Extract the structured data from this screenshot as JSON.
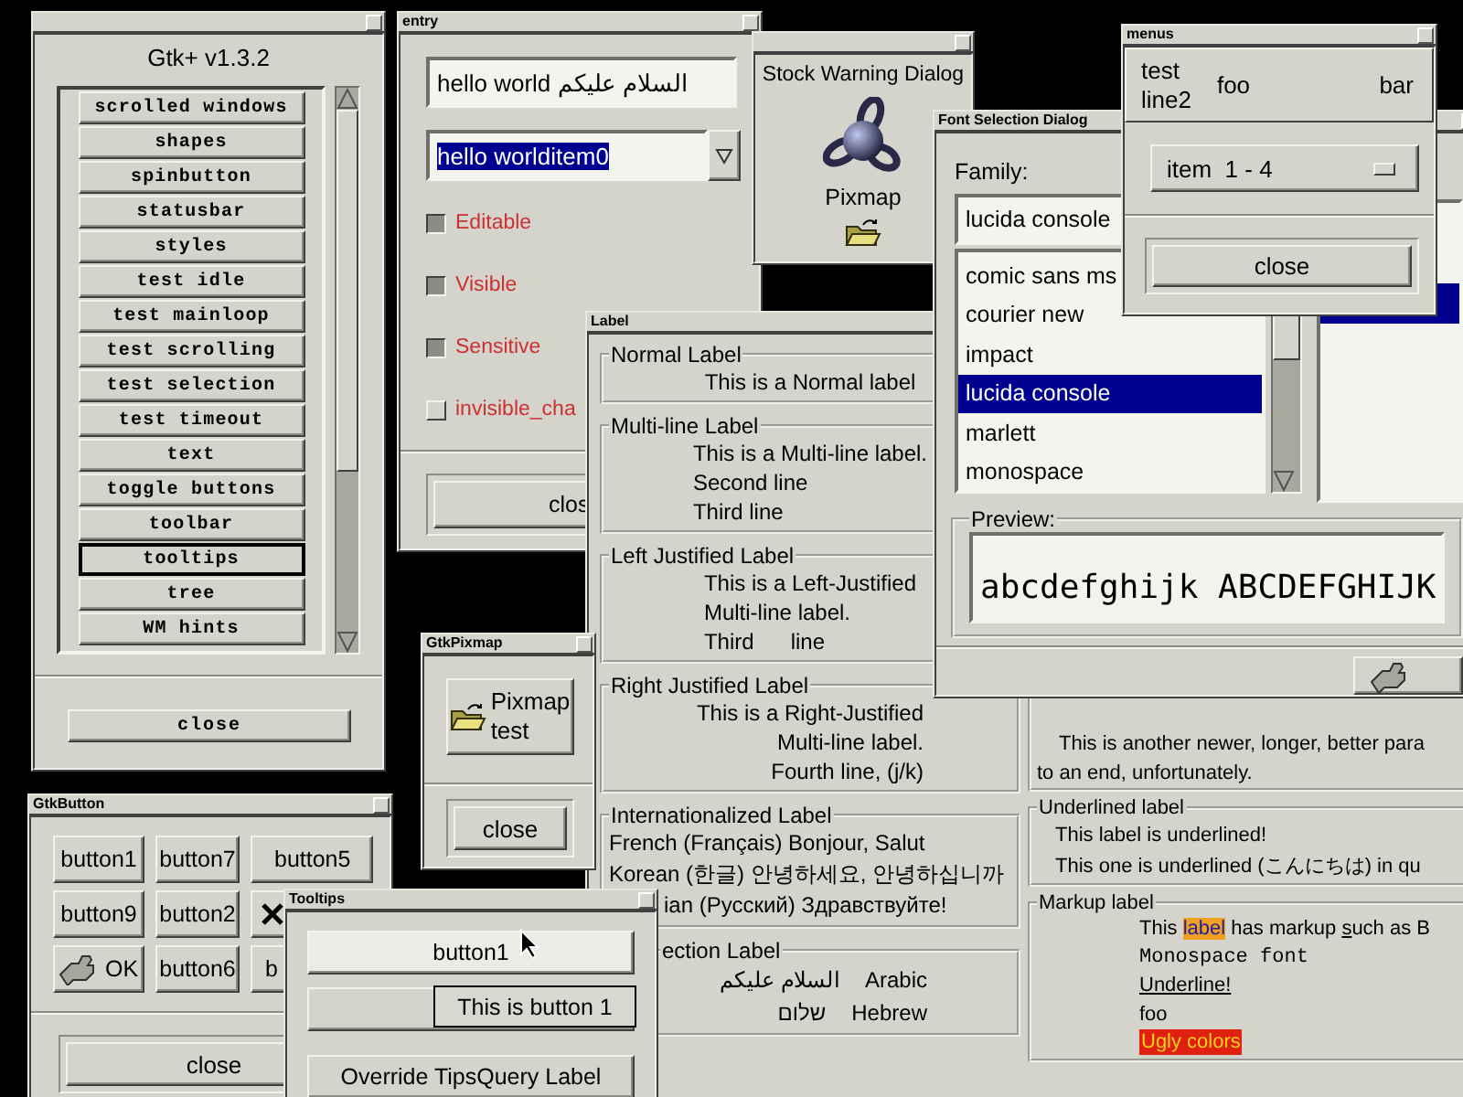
{
  "main_window": {
    "title": "Gtk+ v1.3.2",
    "items": [
      {
        "label": "scrolled windows",
        "focused": false
      },
      {
        "label": "shapes",
        "focused": false
      },
      {
        "label": "spinbutton",
        "focused": false
      },
      {
        "label": "statusbar",
        "focused": false
      },
      {
        "label": "styles",
        "focused": false
      },
      {
        "label": "test idle",
        "focused": false
      },
      {
        "label": "test mainloop",
        "focused": false
      },
      {
        "label": "test scrolling",
        "focused": false
      },
      {
        "label": "test selection",
        "focused": false
      },
      {
        "label": "test timeout",
        "focused": false
      },
      {
        "label": "text",
        "focused": false
      },
      {
        "label": "toggle buttons",
        "focused": false
      },
      {
        "label": "toolbar",
        "focused": false
      },
      {
        "label": "tooltips",
        "focused": true
      },
      {
        "label": "tree",
        "focused": false
      },
      {
        "label": "WM hints",
        "focused": false
      }
    ],
    "close_button": "close"
  },
  "entry_window": {
    "title": "entry",
    "entry_value": "hello world السلام عليكم",
    "combo_value": "hello worlditem0",
    "combo_text_selected": true,
    "checkboxes": [
      {
        "label": "Editable",
        "checked": true
      },
      {
        "label": "Visible",
        "checked": true
      },
      {
        "label": "Sensitive",
        "checked": true
      },
      {
        "label": "invisible_cha",
        "checked": false
      }
    ],
    "close_button": "clos"
  },
  "stock_dialog": {
    "heading": "Stock Warning Dialog",
    "caption": "Pixmap"
  },
  "label_window": {
    "title": "Label",
    "left_frames": [
      {
        "kind": "center",
        "title": "Normal Label",
        "text": "This is a Normal label"
      },
      {
        "kind": "left",
        "title": "Multi-line Label",
        "text": "This is a Multi-line label.\nSecond line\nThird line"
      },
      {
        "kind": "left",
        "title": "Left Justified Label",
        "text": "This is a Left-Justified\nMulti-line label.\nThird      line"
      },
      {
        "kind": "right",
        "title": "Right Justified Label",
        "text": "This is a Right-Justified\nMulti-line label.\nFourth line, (j/k)"
      },
      {
        "kind": "intl",
        "title": "Internationalized Label",
        "lines": [
          "French (Français) Bonjour, Salut",
          "Korean (한글) 안녕하세요, 안녕하십니까",
          "ian (Русский) Здравствуйте!"
        ]
      },
      {
        "kind": "direction",
        "title": "ection Label",
        "lines": [
          {
            "script": "السلام عليكم",
            "language": "Arabic"
          },
          {
            "script": "שלום",
            "language": "Hebrew"
          }
        ]
      }
    ],
    "right_frames": [
      {
        "kind": "paragraph",
        "lines": [
          "This is another newer, longer, better para",
          "to an end, unfortunately."
        ]
      },
      {
        "kind": "underlined",
        "title": "Underlined label",
        "lines": [
          "This label is underlined!",
          "This one is underlined (こんにちは) in qu"
        ]
      },
      {
        "kind": "markup",
        "title": "Markup label",
        "lines": [
          {
            "kind": "rich",
            "parts": [
              {
                "kind": "plain",
                "text": "This "
              },
              {
                "kind": "highlight",
                "text": "label"
              },
              {
                "kind": "plain",
                "text": " has markup "
              },
              {
                "kind": "underline",
                "text": "s"
              },
              {
                "kind": "plain",
                "text": "uch as B"
              }
            ]
          },
          {
            "kind": "mono",
            "text": "Monospace font"
          },
          {
            "kind": "underline",
            "text": "Underline!"
          },
          {
            "kind": "plain",
            "text": "foo"
          },
          {
            "kind": "ugly",
            "text": "Ugly colors"
          }
        ]
      }
    ]
  },
  "font_dialog": {
    "title": "Font Selection Dialog",
    "family_label": "Family:",
    "family_value": "lucida console",
    "families": [
      {
        "name": "comic sans ms",
        "selected": false
      },
      {
        "name": "courier new",
        "selected": false
      },
      {
        "name": "impact",
        "selected": false
      },
      {
        "name": "lucida console",
        "selected": true
      },
      {
        "name": "marlett",
        "selected": false
      },
      {
        "name": "monospace",
        "selected": false
      }
    ],
    "preview_label": "Preview:",
    "preview_text": "abcdefghijk ABCDEFGHIJK"
  },
  "menus_window": {
    "title": "menus",
    "menubar": [
      "test\nline2",
      "foo",
      "bar"
    ],
    "option_menu": "item  1 - 4",
    "close_button": "close"
  },
  "pixmap_window": {
    "title": "GtkPixmap",
    "button_label": "Pixmap\ntest",
    "close_button": "close"
  },
  "button_window": {
    "title": "GtkButton",
    "buttons": [
      {
        "kind": "plain",
        "label": "button1"
      },
      {
        "kind": "plain",
        "label": "button7"
      },
      {
        "kind": "plain",
        "label": "button5"
      },
      {
        "kind": "plain",
        "label": "button9"
      },
      {
        "kind": "plain",
        "label": "button2"
      },
      {
        "kind": "cancel"
      },
      {
        "kind": "confirm",
        "label": "OK"
      },
      {
        "kind": "plain",
        "label": "button6"
      },
      {
        "kind": "plain",
        "label": "b"
      }
    ],
    "close_button": "close"
  },
  "tooltips_window": {
    "title": "Tooltips",
    "buttons": [
      {
        "label": "button1",
        "prelight": true
      },
      {
        "prelight": false
      },
      {
        "label": "Override TipsQuery Label",
        "prelight": false
      }
    ],
    "tooltip": "This is button 1"
  }
}
